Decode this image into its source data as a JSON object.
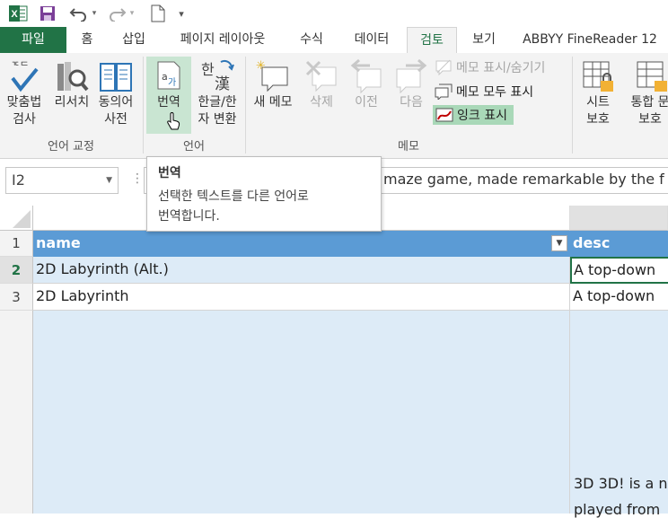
{
  "qat": {
    "customize_glyph": "▾"
  },
  "tabs": [
    {
      "label": "파일"
    },
    {
      "label": "홈"
    },
    {
      "label": "삽입"
    },
    {
      "label": "페이지 레이아웃"
    },
    {
      "label": "수식"
    },
    {
      "label": "데이터"
    },
    {
      "label": "검토"
    },
    {
      "label": "보기"
    },
    {
      "label": "ABBYY FineReader 12"
    }
  ],
  "ribbon": {
    "proofing": {
      "spelling_l1": "맞춤법",
      "spelling_l2": "검사",
      "research": "리서치",
      "thesaurus_l1": "동의어",
      "thesaurus_l2": "사전",
      "group_label": "언어 교정"
    },
    "language": {
      "translate": "번역",
      "hangul_l1": "한글/한",
      "hangul_l2": "자 변환",
      "group_label": "언어"
    },
    "comments": {
      "new": "새 메모",
      "delete": "삭제",
      "previous": "이전",
      "next": "다음",
      "show_hide": "메모 표시/숨기기",
      "show_all": "메모 모두 표시",
      "show_ink": "잉크 표시",
      "group_label": "메모"
    },
    "changes": {
      "protect_sheet_l1": "시트",
      "protect_sheet_l2": "보호",
      "protect_wb_l1": "통합 문",
      "protect_wb_l2": "보호"
    }
  },
  "formula_bar": {
    "name_box": "I2",
    "content": "maze game, made remarkable by the f"
  },
  "tooltip": {
    "title": "번역",
    "line1": "선택한 텍스트를 다른 언어로",
    "line2": "번역합니다."
  },
  "sheet": {
    "header_row": {
      "num": "1",
      "name": "name",
      "desc": "desc"
    },
    "rows": [
      {
        "num": "2",
        "name": "2D Labyrinth (Alt.)",
        "desc": "A top-down"
      },
      {
        "num": "3",
        "name": "2D Labyrinth",
        "desc": "A top-down"
      }
    ],
    "overflow_l1": "3D 3D! is a n",
    "overflow_l2": "played from"
  },
  "colors": {
    "brand_green": "#217346",
    "header_blue": "#5b9bd5",
    "row_light_blue": "#ddebf7",
    "ink_highlight": "#a9d8b8"
  }
}
